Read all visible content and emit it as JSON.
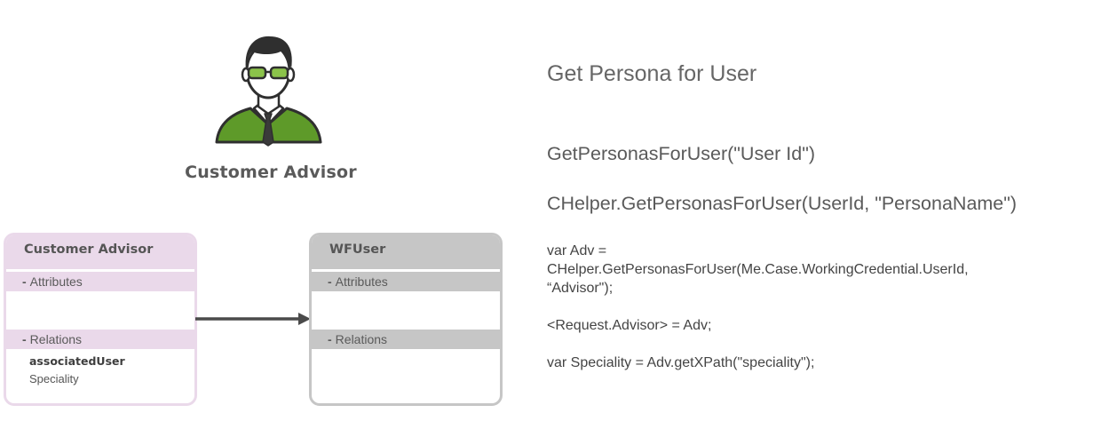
{
  "persona": {
    "label": "Customer Advisor",
    "icon": "business-person-icon",
    "jacket_color": "#5e9a29",
    "glasses_color": "#8bc34a"
  },
  "entities": {
    "customer_advisor": {
      "name": "Customer Advisor",
      "attributes_label": "Attributes",
      "relations_label": "Relations",
      "relations": [
        "associatedUser",
        "Speciality"
      ],
      "color": "#ead9ea"
    },
    "wfuser": {
      "name": "WFUser",
      "attributes_label": "Attributes",
      "relations_label": "Relations",
      "color": "#c6c6c6"
    },
    "collapse_marker": "-"
  },
  "code": {
    "title": "Get Persona for User",
    "signature_1": "GetPersonasForUser(\"User Id\")",
    "signature_2": "CHelper.GetPersonasForUser(UserId, \"PersonaName\")",
    "example": [
      "var Adv =",
      "CHelper.GetPersonasForUser(Me.Case.WorkingCredential.UserId,",
      "“Advisor\");",
      "<Request.Advisor> = Adv;",
      "var Speciality =  Adv.getXPath(\"speciality\");"
    ]
  }
}
